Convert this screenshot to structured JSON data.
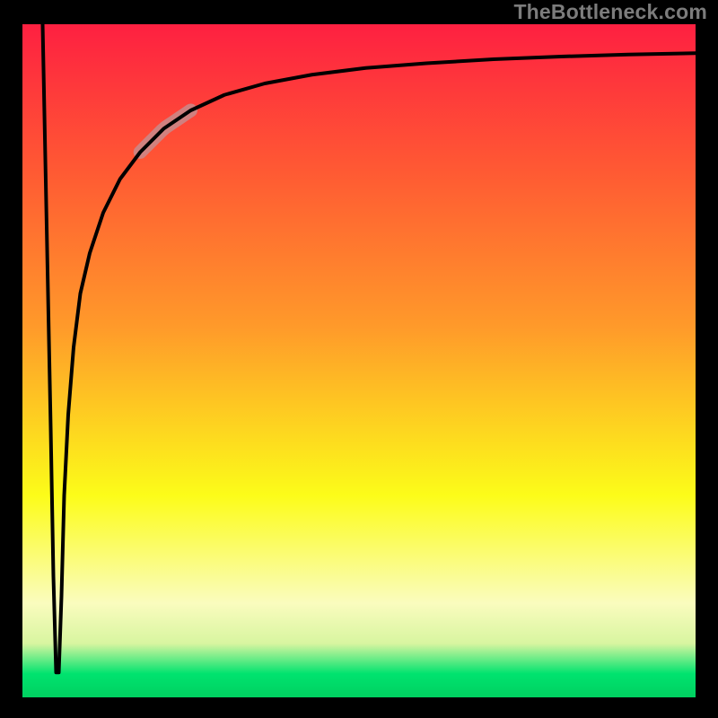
{
  "attribution": "TheBottleneck.com",
  "colors": {
    "bg": "#000000",
    "grad_top": "#fe2041",
    "grad_mid1": "#ff8f2d",
    "grad_mid2": "#fcfc19",
    "grad_pale": "#fafcbe",
    "grad_green": "#00e36f",
    "curve": "#000000",
    "highlight": "#c88b8c"
  },
  "chart_data": {
    "type": "line",
    "title": "",
    "xlabel": "",
    "ylabel": "",
    "xlim": [
      0,
      100
    ],
    "ylim": [
      0,
      100
    ],
    "series": [
      {
        "name": "bottleneck-curve",
        "x": [
          3.0,
          3.6,
          4.2,
          4.6,
          5.0,
          5.4,
          5.8,
          6.2,
          6.8,
          7.6,
          8.6,
          10,
          12,
          14.5,
          17.5,
          21,
          25,
          30,
          36,
          43,
          51,
          60,
          70,
          80,
          90,
          100
        ],
        "y": [
          100,
          70,
          40,
          18,
          3.7,
          3.7,
          15,
          30,
          42,
          52,
          60,
          66,
          72,
          77,
          81,
          84.5,
          87.2,
          89.5,
          91.2,
          92.5,
          93.5,
          94.2,
          94.8,
          95.2,
          95.5,
          95.7
        ]
      }
    ],
    "highlight_segment": {
      "series": "bottleneck-curve",
      "x_start": 17.5,
      "x_end": 25
    },
    "gradient_stops": [
      {
        "offset": 0.0,
        "color": "#fe2041"
      },
      {
        "offset": 0.22,
        "color": "#ff5a33"
      },
      {
        "offset": 0.45,
        "color": "#ff9a2a"
      },
      {
        "offset": 0.7,
        "color": "#fcfc19"
      },
      {
        "offset": 0.86,
        "color": "#fafcbe"
      },
      {
        "offset": 0.92,
        "color": "#d8f5a0"
      },
      {
        "offset": 0.965,
        "color": "#00e36f"
      },
      {
        "offset": 1.0,
        "color": "#00d060"
      }
    ]
  }
}
